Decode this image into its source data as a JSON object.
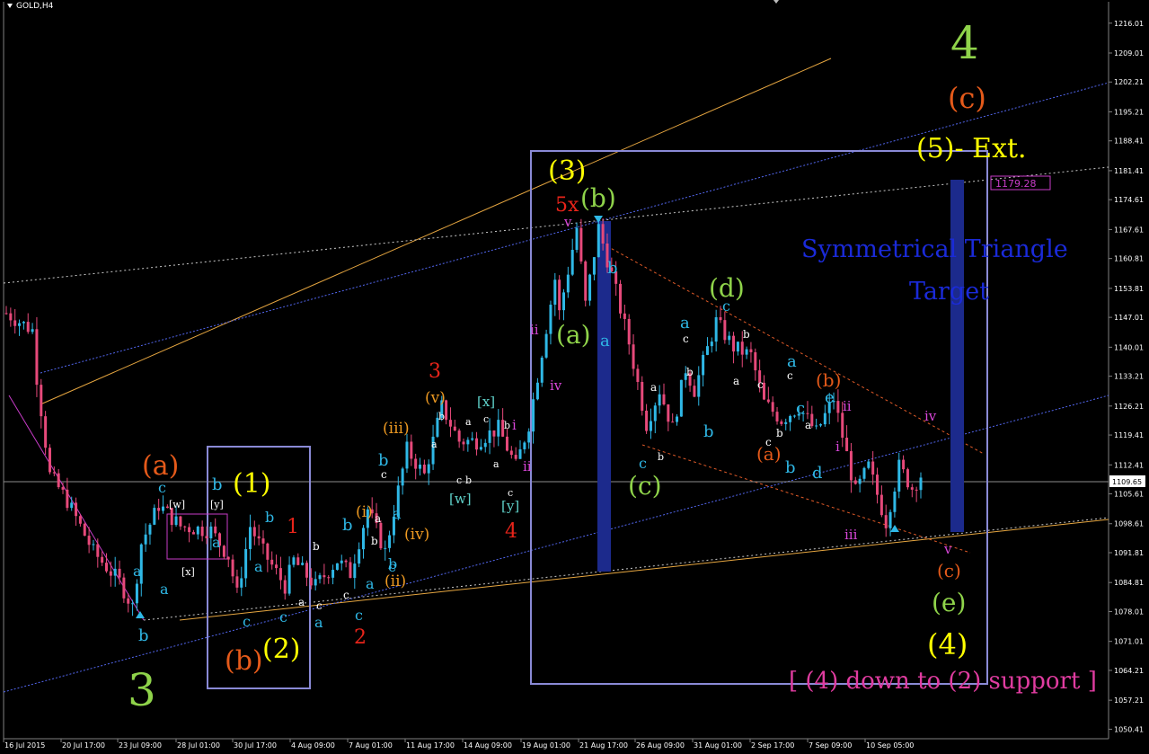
{
  "symbol": "GOLD,H4",
  "current_price": "1109.65",
  "target_price": "1179.28",
  "colors": {
    "bg": "#000000",
    "bull": "#2fb8e6",
    "bear": "#e6497a",
    "bidline": "#8c8c8c",
    "orange_line": "#e6a640",
    "blue_dotted": "#5266ee",
    "white_dotted": "#c8c8c8",
    "box": "#8a8ad6",
    "target_bar": "#1c2a8c",
    "triangle": "#e05a28",
    "price_tag": "#c83cc8"
  },
  "chart_data": {
    "type": "candlestick",
    "timeframe": "H4",
    "y_ticks": [
      "1216.01",
      "1209.01",
      "1202.21",
      "1195.21",
      "1188.41",
      "1181.41",
      "1174.61",
      "1167.61",
      "1160.81",
      "1153.81",
      "1147.01",
      "1140.01",
      "1133.21",
      "1126.21",
      "1119.41",
      "1112.41",
      "1105.61",
      "1098.61",
      "1091.81",
      "1084.81",
      "1078.01",
      "1071.01",
      "1064.21",
      "1057.21",
      "1050.41"
    ],
    "ylim": [
      1048.6,
      1220.6
    ],
    "x_ticks": [
      "16 Jul 2015",
      "20 Jul 17:00",
      "23 Jul 09:00",
      "28 Jul 01:00",
      "30 Jul 17:00",
      "4 Aug 09:00",
      "7 Aug 01:00",
      "11 Aug 17:00",
      "14 Aug 09:00",
      "19 Aug 01:00",
      "21 Aug 17:00",
      "26 Aug 09:00",
      "31 Aug 01:00",
      "2 Sep 17:00",
      "7 Sep 09:00",
      "10 Sep 05:00"
    ],
    "price_path": [
      {
        "i": 0,
        "p": 1148
      },
      {
        "i": 6,
        "p": 1144
      },
      {
        "i": 7,
        "p": 1133
      },
      {
        "i": 10,
        "p": 1110
      },
      {
        "i": 14,
        "p": 1104
      },
      {
        "i": 20,
        "p": 1092
      },
      {
        "i": 26,
        "p": 1085
      },
      {
        "i": 29,
        "p": 1079
      },
      {
        "i": 31,
        "p": 1094
      },
      {
        "i": 35,
        "p": 1103
      },
      {
        "i": 40,
        "p": 1098
      },
      {
        "i": 47,
        "p": 1097
      },
      {
        "i": 51,
        "p": 1091
      },
      {
        "i": 53,
        "p": 1082
      },
      {
        "i": 56,
        "p": 1098
      },
      {
        "i": 59,
        "p": 1092
      },
      {
        "i": 64,
        "p": 1084
      },
      {
        "i": 66,
        "p": 1090
      },
      {
        "i": 71,
        "p": 1084
      },
      {
        "i": 76,
        "p": 1090
      },
      {
        "i": 79,
        "p": 1087
      },
      {
        "i": 83,
        "p": 1102
      },
      {
        "i": 87,
        "p": 1092
      },
      {
        "i": 92,
        "p": 1116
      },
      {
        "i": 96,
        "p": 1110
      },
      {
        "i": 100,
        "p": 1126
      },
      {
        "i": 104,
        "p": 1118
      },
      {
        "i": 108,
        "p": 1118
      },
      {
        "i": 113,
        "p": 1121
      },
      {
        "i": 117,
        "p": 1112
      },
      {
        "i": 120,
        "p": 1122
      },
      {
        "i": 126,
        "p": 1156
      },
      {
        "i": 127,
        "p": 1148
      },
      {
        "i": 131,
        "p": 1168
      },
      {
        "i": 133,
        "p": 1150
      },
      {
        "i": 136,
        "p": 1168
      },
      {
        "i": 139,
        "p": 1157
      },
      {
        "i": 143,
        "p": 1141
      },
      {
        "i": 147,
        "p": 1122
      },
      {
        "i": 150,
        "p": 1130
      },
      {
        "i": 153,
        "p": 1121
      },
      {
        "i": 156,
        "p": 1135
      },
      {
        "i": 158,
        "p": 1130
      },
      {
        "i": 163,
        "p": 1146
      },
      {
        "i": 167,
        "p": 1140
      },
      {
        "i": 171,
        "p": 1138
      },
      {
        "i": 174,
        "p": 1127
      },
      {
        "i": 178,
        "p": 1123
      },
      {
        "i": 182,
        "p": 1126
      },
      {
        "i": 186,
        "p": 1120
      },
      {
        "i": 190,
        "p": 1128
      },
      {
        "i": 195,
        "p": 1106
      },
      {
        "i": 198,
        "p": 1112
      },
      {
        "i": 202,
        "p": 1099
      },
      {
        "i": 205,
        "p": 1112
      },
      {
        "i": 208,
        "p": 1107
      },
      {
        "i": 210,
        "p": 1110
      }
    ],
    "annotations": {
      "cycle_4": "4",
      "cycle_3": "3",
      "wave_c_top": "(c)",
      "wave_5_ext": "(5)- Ext.",
      "wave_3": "(3)",
      "wave_5x": "5x",
      "wave_b_top": "(b)",
      "wave_a": "(a)",
      "wave_d": "(d)",
      "wave_c_mid": "(c)",
      "wave_b_right": "(b)",
      "wave_a_right": "(a)",
      "wave_1": "(1)",
      "wave_2": "(2)",
      "wave_a_left": "(a)",
      "wave_b_left": "(b)",
      "wave_4": "(4)",
      "wave_e": "(e)",
      "wave_c_bottom": "(c)",
      "sub_iii": "(iii)",
      "sub_v": "(v)",
      "sub_i": "(i)",
      "sub_ii": "(ii)",
      "sub_iv": "(iv)",
      "red_3": "3",
      "red_4": "4",
      "red_1": "1",
      "red_2": "2",
      "w_left": "[w]",
      "y_left": "[y]",
      "x_left": "[x]",
      "x_mid": "[x]",
      "w_mid": "[w]",
      "y_mid": "[y]",
      "tri_line1": "Symmetrical Triangle",
      "tri_line2": "Target",
      "support_note": "[ (4) down to (2) support ]",
      "ii": "ii",
      "iv": "iv",
      "iii": "iii",
      "i": "i",
      "v": "v",
      "a": "a",
      "b": "b",
      "c": "c",
      "d": "d",
      "e": "e"
    }
  }
}
